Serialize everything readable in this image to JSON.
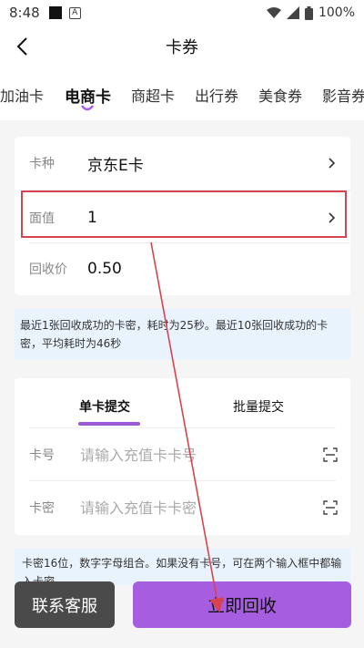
{
  "status": {
    "time": "8:48",
    "battery": "100%"
  },
  "header": {
    "title": "卡券"
  },
  "tabs": [
    {
      "label": "加油卡"
    },
    {
      "label": "电商卡"
    },
    {
      "label": "商超卡"
    },
    {
      "label": "出行券"
    },
    {
      "label": "美食券"
    },
    {
      "label": "影音券"
    }
  ],
  "form": {
    "card_type_label": "卡种",
    "card_type_value": "京东E卡",
    "face_value_label": "面值",
    "face_value_value": "1",
    "recycle_price_label": "回收价",
    "recycle_price_value": "0.50"
  },
  "info": {
    "text": "最近1张回收成功的卡密，耗时为25秒。最近10张回收成功的卡密，平均耗时为46秒"
  },
  "submit": {
    "single_tab": "单卡提交",
    "batch_tab": "批量提交",
    "card_no_label": "卡号",
    "card_no_placeholder": "请输入充值卡卡号",
    "card_pwd_label": "卡密",
    "card_pwd_placeholder": "请输入充值卡卡密"
  },
  "note": {
    "text": "卡密16位，数字字母组合。如果没有卡号，可在两个输入框中都输入卡密"
  },
  "buttons": {
    "service": "联系客服",
    "recycle": "立即回收"
  },
  "colors": {
    "accent": "#a75de0",
    "highlight": "#d9434f",
    "info_bg": "#e9f3fe"
  }
}
